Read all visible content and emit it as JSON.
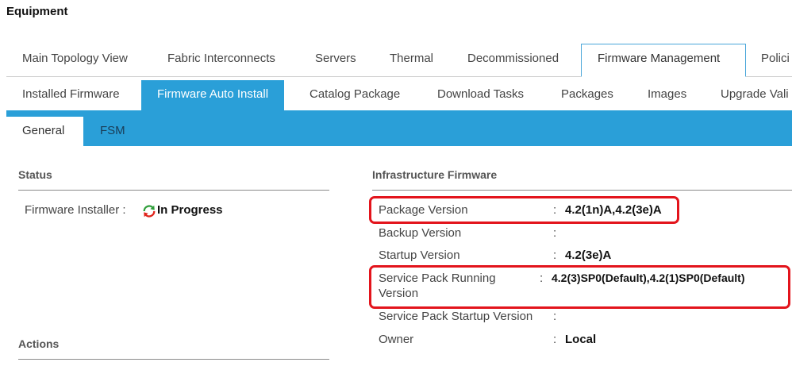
{
  "page": {
    "title": "Equipment"
  },
  "tabs_level1": [
    "Main Topology View",
    "Fabric Interconnects",
    "Servers",
    "Thermal",
    "Decommissioned",
    "Firmware Management",
    "Polici"
  ],
  "tabs_level2": [
    "Installed Firmware",
    "Firmware Auto Install",
    "Catalog Package",
    "Download Tasks",
    "Packages",
    "Images",
    "Upgrade Vali"
  ],
  "tabs_level3": [
    "General",
    "FSM"
  ],
  "status": {
    "heading": "Status",
    "installer_label": "Firmware Installer :",
    "installer_value": "In Progress",
    "icon": "refresh-progress-icon"
  },
  "actions": {
    "heading": "Actions"
  },
  "infra": {
    "heading": "Infrastructure Firmware",
    "package_label": "Package Version",
    "package_value": "4.2(1n)A,4.2(3e)A",
    "backup_label": "Backup Version",
    "backup_value": "",
    "startup_label": "Startup Version",
    "startup_value": "4.2(3e)A",
    "sp_running_label_1": "Service Pack Running",
    "sp_running_label_2": "Version",
    "sp_running_value": "4.2(3)SP0(Default),4.2(1)SP0(Default)",
    "sp_startup_label": "Service Pack Startup Version",
    "sp_startup_value": "",
    "owner_label": "Owner",
    "owner_value": "Local",
    "colon": ":"
  },
  "colors": {
    "accent": "#2a9fd8",
    "highlight": "#e3141c"
  }
}
